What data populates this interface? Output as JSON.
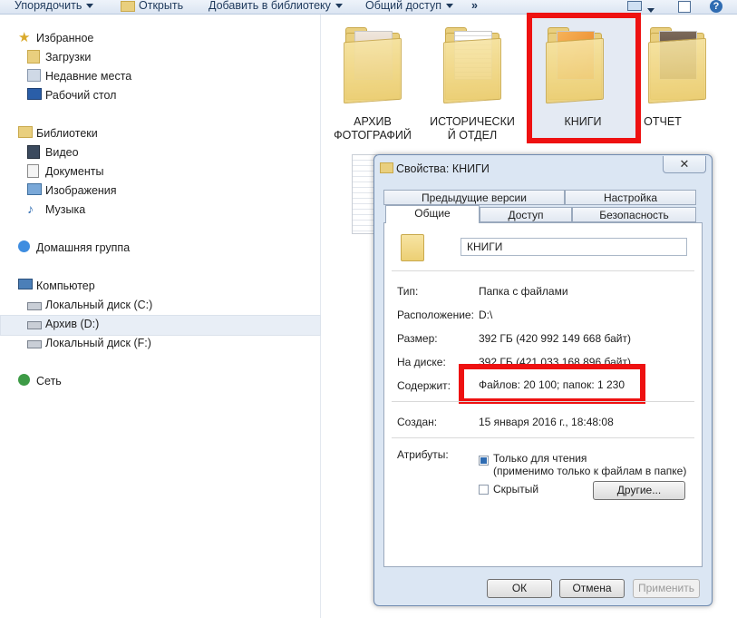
{
  "toolbar": {
    "organize": "Упорядочить",
    "open": "Открыть",
    "add_library": "Добавить в библиотеку",
    "share": "Общий доступ",
    "more": "»"
  },
  "nav": {
    "favorites": "Избранное",
    "downloads": "Загрузки",
    "recent": "Недавние места",
    "desktop": "Рабочий стол",
    "libraries": "Библиотеки",
    "video": "Видео",
    "documents": "Документы",
    "images": "Изображения",
    "music": "Музыка",
    "homegroup": "Домашняя группа",
    "computer": "Компьютер",
    "disk_c": "Локальный диск (C:)",
    "disk_d": "Архив (D:)",
    "disk_f": "Локальный диск (F:)",
    "network": "Сеть"
  },
  "folders": [
    {
      "line1": "АРХИВ",
      "line2": "ФОТОГРАФИЙ"
    },
    {
      "line1": "ИСТОРИЧЕСКИ",
      "line2": "Й ОТДЕЛ"
    },
    {
      "line1": "КНИГИ",
      "line2": ""
    },
    {
      "line1": "ОТЧЕТ",
      "line2": ""
    }
  ],
  "dialog": {
    "title": "Свойства: КНИГИ",
    "close": "✕",
    "tabs": {
      "prev_versions": "Предыдущие версии",
      "customize": "Настройка",
      "general": "Общие",
      "sharing": "Доступ",
      "security": "Безопасность"
    },
    "name": "КНИГИ",
    "type_label": "Тип:",
    "type_value": "Папка с файлами",
    "location_label": "Расположение:",
    "location_value": "D:\\",
    "size_label": "Размер:",
    "size_value": "392 ГБ (420 992 149 668 байт)",
    "disk_label": "На диске:",
    "disk_value": "392 ГБ (421 033 168 896 байт)",
    "contains_label": "Содержит:",
    "contains_value": "Файлов: 20 100; папок: 1 230",
    "created_label": "Создан:",
    "created_value": "15 января 2016 г., 18:48:08",
    "attributes_label": "Атрибуты:",
    "readonly_label": "Только для чтения",
    "readonly_note": "(применимо только к файлам в папке)",
    "hidden_label": "Скрытый",
    "other_button": "Другие...",
    "ok": "ОК",
    "cancel": "Отмена",
    "apply": "Применить"
  }
}
